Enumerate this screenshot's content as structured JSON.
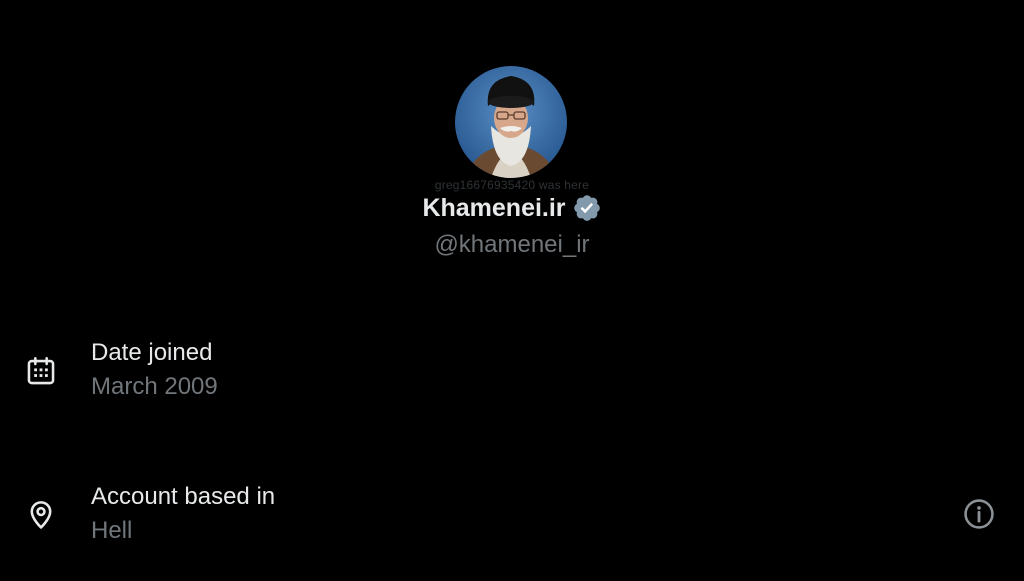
{
  "profile": {
    "display_name": "Khamenei.ir",
    "handle": "@khamenei_ir",
    "watermark": "greg16676935420 was here",
    "verified": true,
    "verified_color": "#829aab"
  },
  "about": {
    "date_joined": {
      "label": "Date joined",
      "value": "March 2009",
      "icon": "calendar-icon"
    },
    "account_based_in": {
      "label": "Account based in",
      "value": "Hell",
      "icon": "location-pin-icon",
      "info_icon": "info-icon"
    }
  },
  "colors": {
    "background": "#000000",
    "primary_text": "#e7e9ea",
    "secondary_text": "#71767b"
  }
}
